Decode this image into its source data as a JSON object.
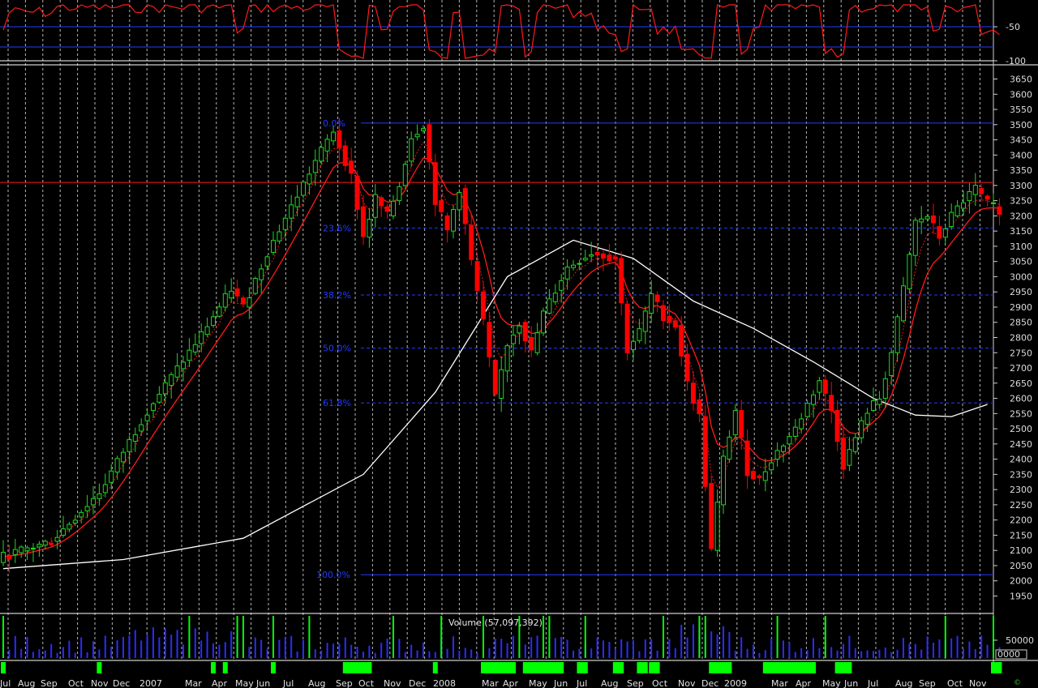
{
  "chart_data": {
    "type": "candlestick",
    "months": [
      "Jul",
      "Aug",
      "Sep",
      "Oct",
      "Nov",
      "Dec",
      "2007",
      "Mar",
      "Apr",
      "May",
      "Jun",
      "Jul",
      "Aug",
      "Sep",
      "Oct",
      "Nov",
      "Dec",
      "2008",
      "Mar",
      "Apr",
      "May",
      "Jun",
      "Jul",
      "Aug",
      "Sep",
      "Oct",
      "Nov",
      "Dec",
      "2009",
      "Mar",
      "Apr",
      "May",
      "Jun",
      "Jul",
      "Aug",
      "Sep",
      "Oct",
      "Nov"
    ],
    "price_axis": {
      "ylim": [
        1900,
        3700
      ],
      "ticks": [
        3650,
        3600,
        3550,
        3500,
        3450,
        3400,
        3350,
        3300,
        3250,
        3200,
        3150,
        3100,
        3050,
        3000,
        2950,
        2900,
        2850,
        2800,
        2750,
        2700,
        2650,
        2600,
        2550,
        2500,
        2450,
        2400,
        2350,
        2300,
        2250,
        2200,
        2150,
        2100,
        2050,
        2000,
        1950
      ]
    },
    "oscillator_axis": {
      "ticks": [
        "-50",
        "-100"
      ]
    },
    "volume": {
      "title": "Volume (57,097,392)",
      "tick_label": "50000",
      "box_label": "0000"
    },
    "horizontal_lines": {
      "resistance": 3310
    },
    "fibonacci": [
      {
        "label": "0.0%",
        "value": 3505
      },
      {
        "label": "23.6%",
        "value": 3160
      },
      {
        "label": "38.2%",
        "value": 2940
      },
      {
        "label": "50.0%",
        "value": 2765
      },
      {
        "label": "61.8%",
        "value": 2585
      },
      {
        "label": "100.0%",
        "value": 2020
      }
    ],
    "anchors": [
      [
        0,
        2080
      ],
      [
        8,
        2130
      ],
      [
        16,
        2290
      ],
      [
        24,
        2560
      ],
      [
        32,
        2780
      ],
      [
        38,
        2960
      ],
      [
        40,
        2900
      ],
      [
        44,
        3080
      ],
      [
        48,
        3230
      ],
      [
        52,
        3380
      ],
      [
        55,
        3480
      ],
      [
        58,
        3330
      ],
      [
        60,
        3130
      ],
      [
        62,
        3260
      ],
      [
        64,
        3200
      ],
      [
        66,
        3300
      ],
      [
        68,
        3460
      ],
      [
        70,
        3500
      ],
      [
        72,
        3250
      ],
      [
        74,
        3150
      ],
      [
        76,
        3290
      ],
      [
        78,
        3050
      ],
      [
        80,
        2850
      ],
      [
        82,
        2600
      ],
      [
        84,
        2780
      ],
      [
        86,
        2850
      ],
      [
        88,
        2750
      ],
      [
        90,
        2880
      ],
      [
        94,
        3030
      ],
      [
        98,
        3080
      ],
      [
        102,
        3060
      ],
      [
        104,
        2760
      ],
      [
        106,
        2820
      ],
      [
        108,
        2940
      ],
      [
        110,
        2870
      ],
      [
        112,
        2840
      ],
      [
        114,
        2650
      ],
      [
        116,
        2540
      ],
      [
        118,
        2100
      ],
      [
        120,
        2400
      ],
      [
        122,
        2560
      ],
      [
        124,
        2360
      ],
      [
        126,
        2330
      ],
      [
        128,
        2400
      ],
      [
        130,
        2450
      ],
      [
        132,
        2500
      ],
      [
        136,
        2660
      ],
      [
        138,
        2560
      ],
      [
        140,
        2380
      ],
      [
        142,
        2470
      ],
      [
        144,
        2560
      ],
      [
        146,
        2600
      ],
      [
        148,
        2750
      ],
      [
        150,
        2960
      ],
      [
        152,
        3180
      ],
      [
        154,
        3200
      ],
      [
        156,
        3130
      ],
      [
        158,
        3200
      ],
      [
        160,
        3250
      ],
      [
        162,
        3290
      ],
      [
        164,
        3240
      ],
      [
        166,
        3220
      ]
    ],
    "ma_slow": [
      [
        0,
        2040
      ],
      [
        20,
        2070
      ],
      [
        40,
        2140
      ],
      [
        60,
        2350
      ],
      [
        72,
        2620
      ],
      [
        84,
        3000
      ],
      [
        95,
        3120
      ],
      [
        105,
        3060
      ],
      [
        115,
        2920
      ],
      [
        125,
        2830
      ],
      [
        135,
        2720
      ],
      [
        145,
        2600
      ],
      [
        152,
        2545
      ],
      [
        158,
        2540
      ],
      [
        164,
        2580
      ]
    ],
    "volume_green_bars": [
      0,
      31,
      39,
      40,
      45,
      51,
      65,
      73,
      80,
      86,
      90,
      91,
      97,
      110,
      116,
      117,
      129,
      137,
      157,
      165
    ],
    "signal_blocks": [
      [
        0,
        0
      ],
      [
        16,
        16
      ],
      [
        35,
        35
      ],
      [
        37,
        37
      ],
      [
        45,
        45
      ],
      [
        57,
        61
      ],
      [
        72,
        72
      ],
      [
        80,
        85
      ],
      [
        87,
        93
      ],
      [
        96,
        97
      ],
      [
        102,
        103
      ],
      [
        106,
        107
      ],
      [
        108,
        109
      ],
      [
        118,
        121
      ],
      [
        127,
        135
      ],
      [
        139,
        141
      ],
      [
        165,
        166
      ]
    ]
  },
  "colors": {
    "bull": "#1fd71f",
    "bear": "#ff0000",
    "ma_slow": "#ffffff",
    "fib": "#1f3cff",
    "grid": "#d8d8d8",
    "volume_bar": "#2c2cff",
    "signal": "#00ff00"
  },
  "copyright": "©"
}
